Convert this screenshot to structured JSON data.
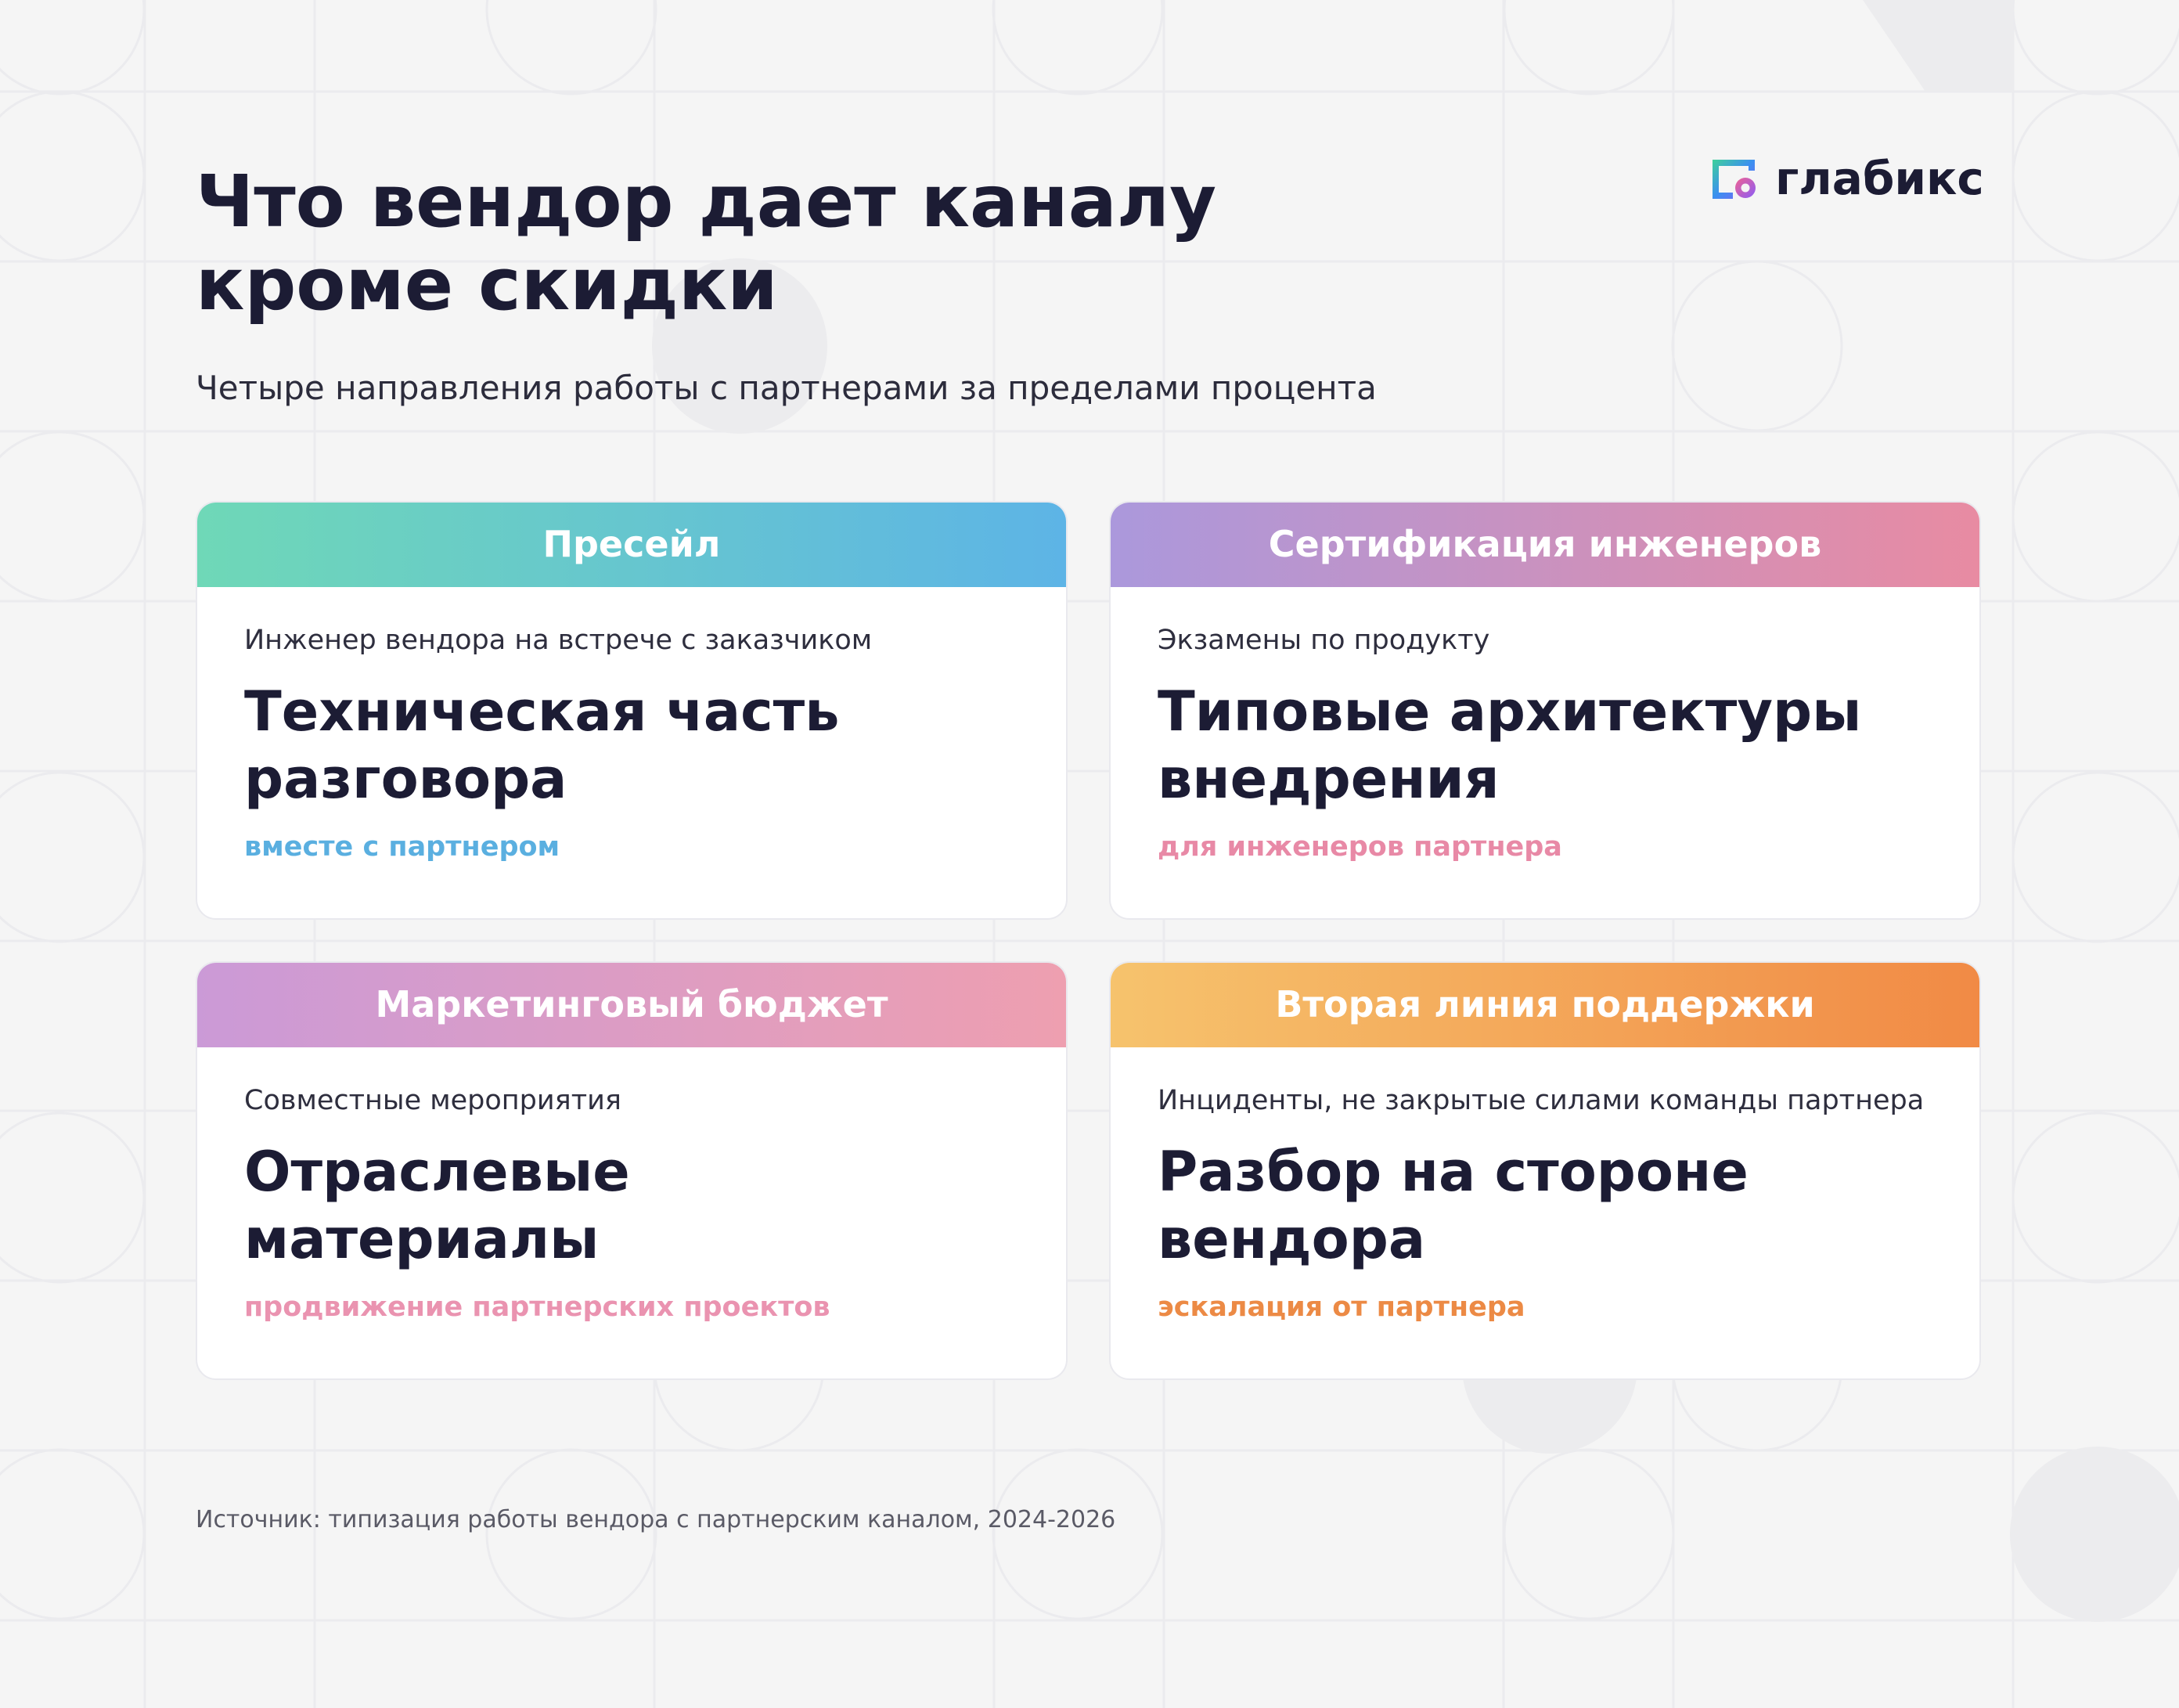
{
  "header": {
    "title": "Что вендор дает каналу кроме скидки",
    "subtitle": "Четыре направления работы с партнерами за пределами процента"
  },
  "logo": {
    "icon": "glabix-logo-icon",
    "text": "глабикс"
  },
  "cards": [
    {
      "header": "Пресейл",
      "label": "Инженер вендора на встрече с заказчиком",
      "heading": "Техническая часть разговора",
      "note": "вместе с партнером",
      "accent": "#5aafe0"
    },
    {
      "header": "Сертификация инженеров",
      "label": "Экзамены по продукту",
      "heading": "Типовые архитектуры внедрения",
      "note": "для инженеров партнера",
      "accent": "#e889a6"
    },
    {
      "header": "Маркетинговый бюджет",
      "label": "Совместные мероприятия",
      "heading": "Отраслевые материалы",
      "note": "продвижение партнерских проектов",
      "accent": "#ea93b0"
    },
    {
      "header": "Вторая линия поддержки",
      "label": "Инциденты, не закрытые силами команды партнера",
      "heading": "Разбор на стороне вендора",
      "note": "эскалация от партнера",
      "accent": "#ec8a45"
    }
  ],
  "footer": {
    "source": "Источник: типизация работы вендора с партнерским каналом, 2024-2026"
  }
}
